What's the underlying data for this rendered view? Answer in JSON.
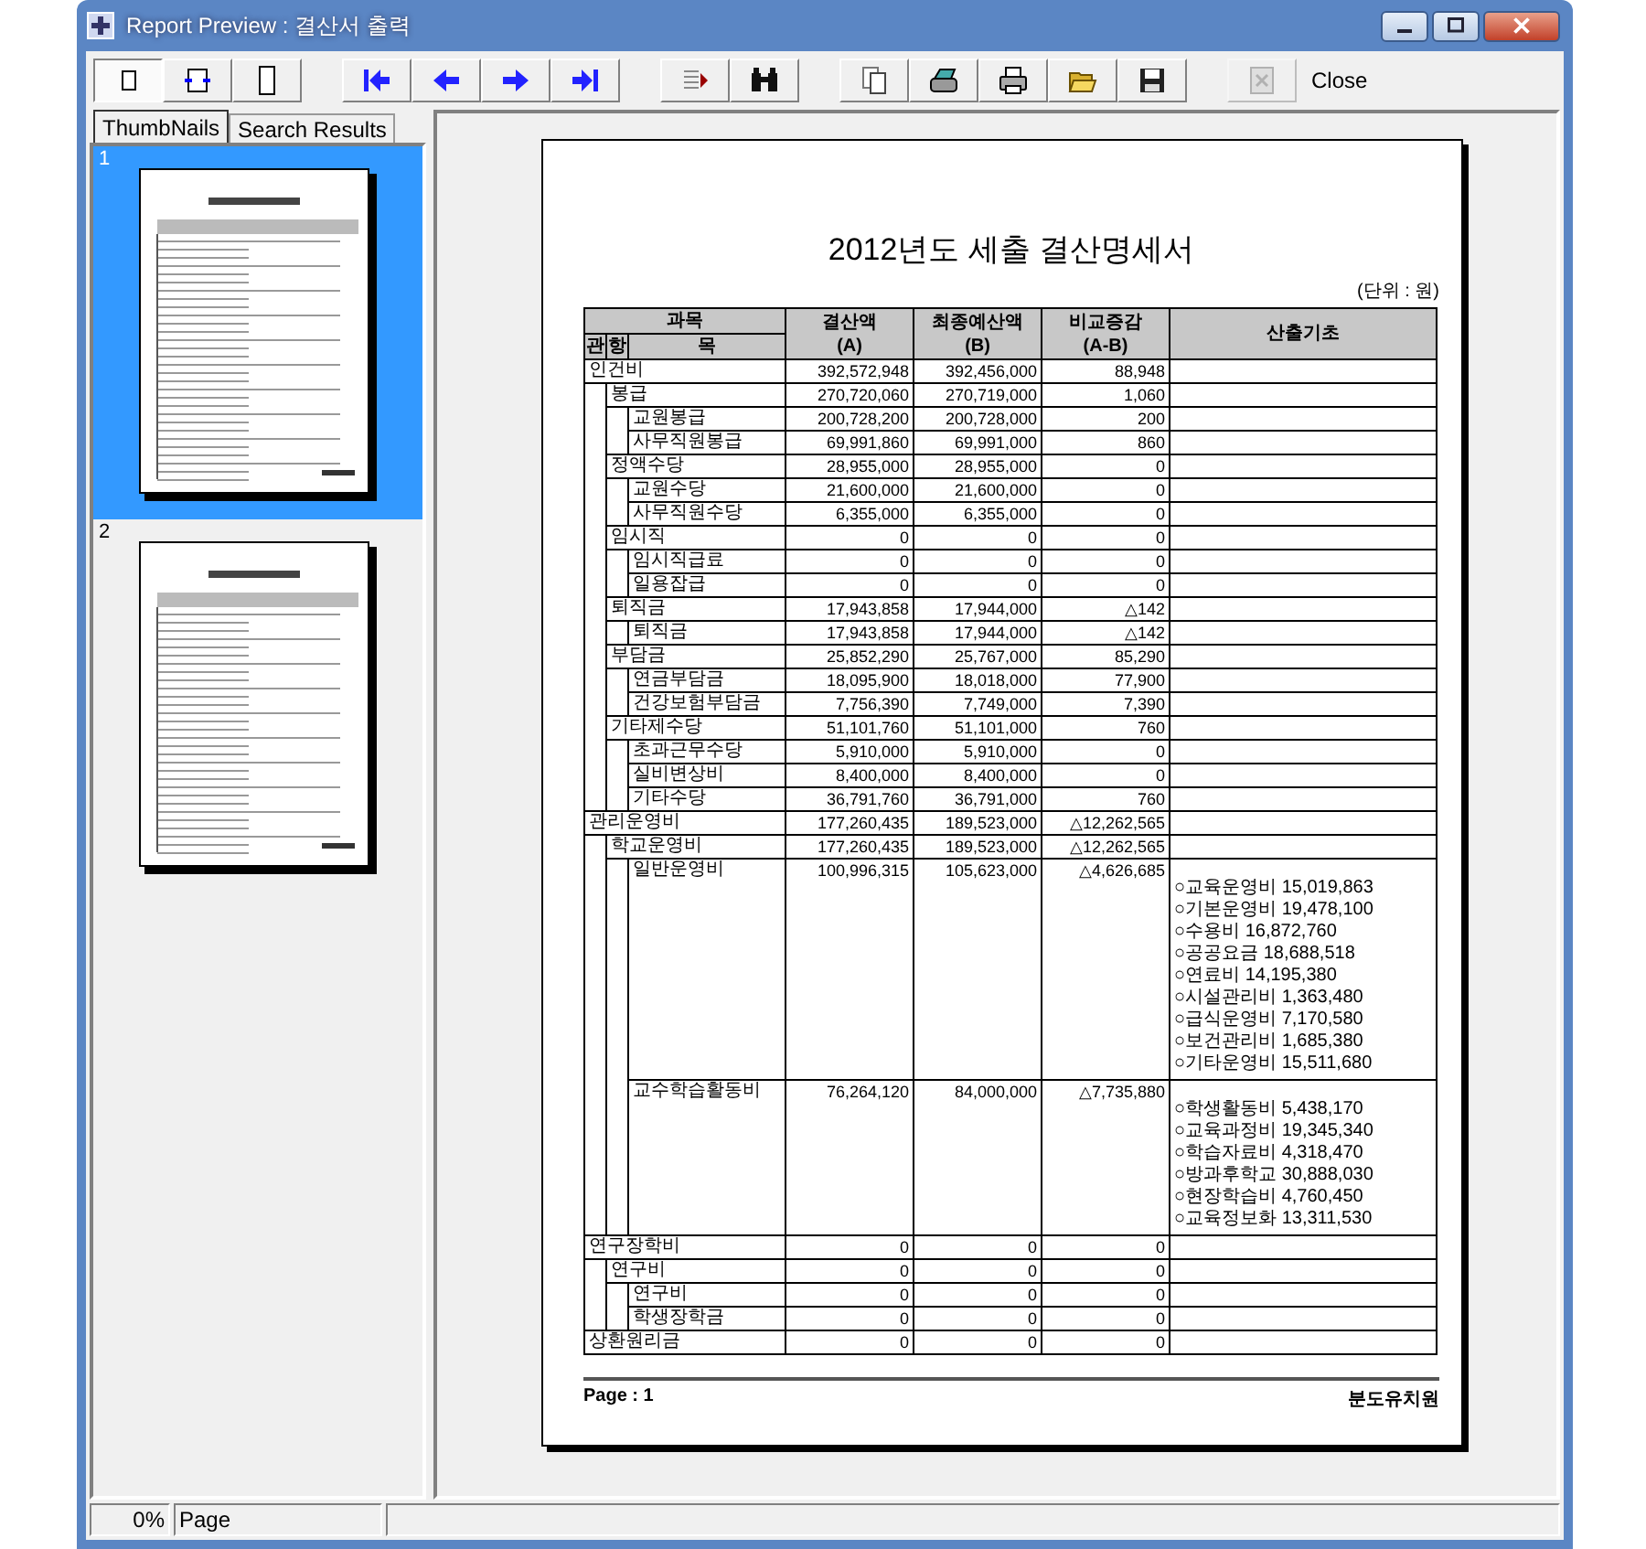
{
  "window": {
    "title": "Report Preview : 결산서 출력"
  },
  "toolbar": {
    "view_buttons": [
      {
        "selected": true
      },
      {
        "selected": false
      },
      {
        "selected": false
      }
    ],
    "stop_button": {
      "disabled": true
    },
    "close_button": {
      "label": "Close"
    }
  },
  "side_tabs": [
    {
      "label": "ThumbNails",
      "selected": true
    },
    {
      "label": "Search Results",
      "selected": false
    }
  ],
  "thumbnails": [
    {
      "number": "1",
      "selected": true
    },
    {
      "number": "2",
      "selected": false
    }
  ],
  "report": {
    "title": "2012년도 세출 결산명세서",
    "unit": "(단위 : 원)",
    "header": {
      "subject": "과목",
      "levels": [
        "관",
        "항",
        "목"
      ],
      "columns": [
        {
          "label": "결산액",
          "sub": "(A)"
        },
        {
          "label": "최종예산액",
          "sub": "(B)"
        },
        {
          "label": "비교증감",
          "sub": "(A-B)"
        }
      ],
      "basis": "산출기초"
    },
    "rows": [
      {
        "name": "인건비",
        "settled": "392,572,948",
        "budget": "392,456,000",
        "diff": "88,948",
        "children": [
          {
            "name": "봉급",
            "settled": "270,720,060",
            "budget": "270,719,000",
            "diff": "1,060",
            "children": [
              {
                "name": "교원봉급",
                "settled": "200,728,200",
                "budget": "200,728,000",
                "diff": "200"
              },
              {
                "name": "사무직원봉급",
                "settled": "69,991,860",
                "budget": "69,991,000",
                "diff": "860"
              }
            ]
          },
          {
            "name": "정액수당",
            "settled": "28,955,000",
            "budget": "28,955,000",
            "diff": "0",
            "children": [
              {
                "name": "교원수당",
                "settled": "21,600,000",
                "budget": "21,600,000",
                "diff": "0"
              },
              {
                "name": "사무직원수당",
                "settled": "6,355,000",
                "budget": "6,355,000",
                "diff": "0"
              }
            ]
          },
          {
            "name": "임시직",
            "settled": "0",
            "budget": "0",
            "diff": "0",
            "children": [
              {
                "name": "임시직급료",
                "settled": "0",
                "budget": "0",
                "diff": "0"
              },
              {
                "name": "일용잡급",
                "settled": "0",
                "budget": "0",
                "diff": "0"
              }
            ]
          },
          {
            "name": "퇴직금",
            "settled": "17,943,858",
            "budget": "17,944,000",
            "diff": "△142",
            "children": [
              {
                "name": "퇴직금",
                "settled": "17,943,858",
                "budget": "17,944,000",
                "diff": "△142"
              }
            ]
          },
          {
            "name": "부담금",
            "settled": "25,852,290",
            "budget": "25,767,000",
            "diff": "85,290",
            "children": [
              {
                "name": "연금부담금",
                "settled": "18,095,900",
                "budget": "18,018,000",
                "diff": "77,900"
              },
              {
                "name": "건강보험부담금",
                "settled": "7,756,390",
                "budget": "7,749,000",
                "diff": "7,390"
              }
            ]
          },
          {
            "name": "기타제수당",
            "settled": "51,101,760",
            "budget": "51,101,000",
            "diff": "760",
            "children": [
              {
                "name": "초과근무수당",
                "settled": "5,910,000",
                "budget": "5,910,000",
                "diff": "0"
              },
              {
                "name": "실비변상비",
                "settled": "8,400,000",
                "budget": "8,400,000",
                "diff": "0"
              },
              {
                "name": "기타수당",
                "settled": "36,791,760",
                "budget": "36,791,000",
                "diff": "760"
              }
            ]
          }
        ]
      },
      {
        "name": "관리운영비",
        "settled": "177,260,435",
        "budget": "189,523,000",
        "diff": "△12,262,565",
        "children": [
          {
            "name": "학교운영비",
            "settled": "177,260,435",
            "budget": "189,523,000",
            "diff": "△12,262,565",
            "children": [
              {
                "name": "일반운영비",
                "settled": "100,996,315",
                "budget": "105,623,000",
                "diff": "△4,626,685",
                "notes": [
                  "○교육운영비 15,019,863",
                  "○기본운영비 19,478,100",
                  "○수용비 16,872,760",
                  "○공공요금 18,688,518",
                  "○연료비 14,195,380",
                  "○시설관리비 1,363,480",
                  "○급식운영비 7,170,580",
                  "○보건관리비 1,685,380",
                  "○기타운영비 15,511,680"
                ]
              },
              {
                "name": "교수학습활동비",
                "settled": "76,264,120",
                "budget": "84,000,000",
                "diff": "△7,735,880",
                "notes": [
                  "○학생활동비 5,438,170",
                  "○교육과정비 19,345,340",
                  "○학습자료비 4,318,470",
                  "○방과후학교 30,888,030",
                  "○현장학습비 4,760,450",
                  "○교육정보화 13,311,530"
                ]
              }
            ]
          }
        ]
      },
      {
        "name": "연구장학비",
        "settled": "0",
        "budget": "0",
        "diff": "0",
        "children": [
          {
            "name": "연구비",
            "settled": "0",
            "budget": "0",
            "diff": "0",
            "children": [
              {
                "name": "연구비",
                "settled": "0",
                "budget": "0",
                "diff": "0"
              },
              {
                "name": "학생장학금",
                "settled": "0",
                "budget": "0",
                "diff": "0"
              }
            ]
          }
        ]
      },
      {
        "name": "상환원리금",
        "settled": "0",
        "budget": "0",
        "diff": "0"
      }
    ],
    "footer": {
      "page": "Page : 1",
      "org": "분도유치원"
    }
  },
  "status_bar": {
    "progress": "0%",
    "mode": "Page"
  }
}
